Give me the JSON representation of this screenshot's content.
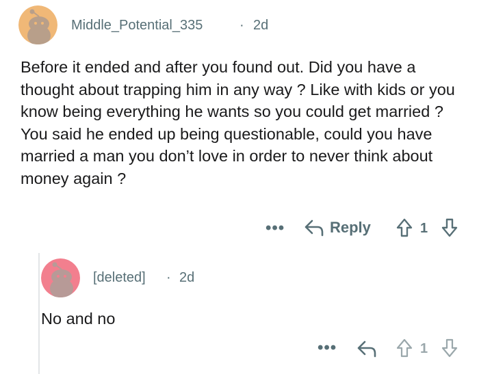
{
  "comment": {
    "username": "Middle_Potential_335",
    "separator": "·",
    "age": "2d",
    "avatar_icon": "snoo-avatar-orange",
    "body": "Before it ended and after you found out. Did you have a thought about trapping him in any way ? Like with kids or you know being everything he wants so you could get married ? You said he ended up being questionable, could you have married a man you don’t love in order to never think about money again ?",
    "actions": {
      "more_label": "•••",
      "reply_label": "Reply",
      "score": "1"
    }
  },
  "reply": {
    "username": "[deleted]",
    "separator": "·",
    "age": "2d",
    "avatar_icon": "snoo-avatar-pink",
    "body": "No and no",
    "actions": {
      "more_label": "•••",
      "score": "1"
    }
  },
  "colors": {
    "avatar_orange": "#f0b877",
    "avatar_pink": "#f27f8e",
    "meta_gray": "#576f76",
    "text": "#1a1a1b"
  }
}
